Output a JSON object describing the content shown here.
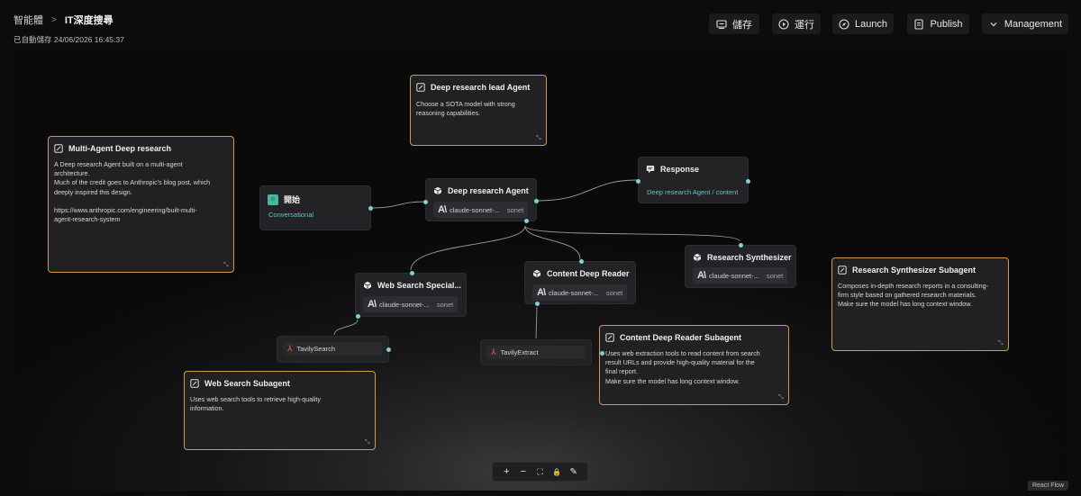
{
  "breadcrumb": {
    "root": "智能體",
    "current": "IT深度搜尋"
  },
  "autosave": "已自動儲存 24/06/2026 16:45:37",
  "toolbar": {
    "save_label": "儲存",
    "run_label": "運行",
    "launch_label": "Launch",
    "publish_label": "Publish",
    "management_label": "Management"
  },
  "notes": {
    "lead": {
      "title": "Deep research lead Agent",
      "body": "Choose a SOTA model with strong\nreasoning capabilities."
    },
    "multi": {
      "title": "Multi-Agent Deep research",
      "body": "A Deep research Agent built on a multi-agent\narchitecture.\nMuch of the credit goes to Anthropic's blog post, which\ndeeply inspired this design.\n\nhttps://www.anthropic.com/engineering/built-multi-\nagent-research-system"
    },
    "synth_sub": {
      "title": "Research Synthesizer Subagent",
      "body": "Composes in-depth research reports in a consulting-\nfirm style based on gathered research materials.\nMake sure the model has long context window."
    },
    "reader_sub": {
      "title": "Content Deep Reader Subagent",
      "body": "Uses web extraction tools to read content from search\nresult URLs and provide high-quality material for the\nfinal report.\nMake sure the model has long context window."
    },
    "search_sub": {
      "title": "Web Search Subagent",
      "body": "Uses web search tools to retrieve high-quality\ninformation."
    }
  },
  "nodes": {
    "start": {
      "title": "開始",
      "subtitle": "Conversational"
    },
    "deep_agent": {
      "title": "Deep research Agent",
      "model": "claude-sonnet-...",
      "tag": "sonet"
    },
    "response": {
      "title": "Response",
      "subtitle": "Deep research Agent / content"
    },
    "synthesizer": {
      "title": "Research Synthesizer",
      "model": "claude-sonnet-...",
      "tag": "sonet"
    },
    "reader": {
      "title": "Content Deep Reader",
      "model": "claude-sonnet-...",
      "tag": "sonet"
    },
    "web_search": {
      "title": "Web Search Special...",
      "model": "claude-sonnet-...",
      "tag": "sonet"
    },
    "tavily_search": {
      "title": "TavilySearch"
    },
    "tavily_extract": {
      "title": "TavilyExtract"
    }
  },
  "controls": {
    "zoom_in": "+",
    "zoom_out": "−",
    "fit": "⛶",
    "lock": "🔒",
    "note": "✎"
  },
  "attribution": "React Flow",
  "colors": {
    "note_border": "#d29a45",
    "port": "#7fd0d6",
    "accent_text": "#5fc4c9",
    "tool_icon": "#ef6a4a"
  }
}
